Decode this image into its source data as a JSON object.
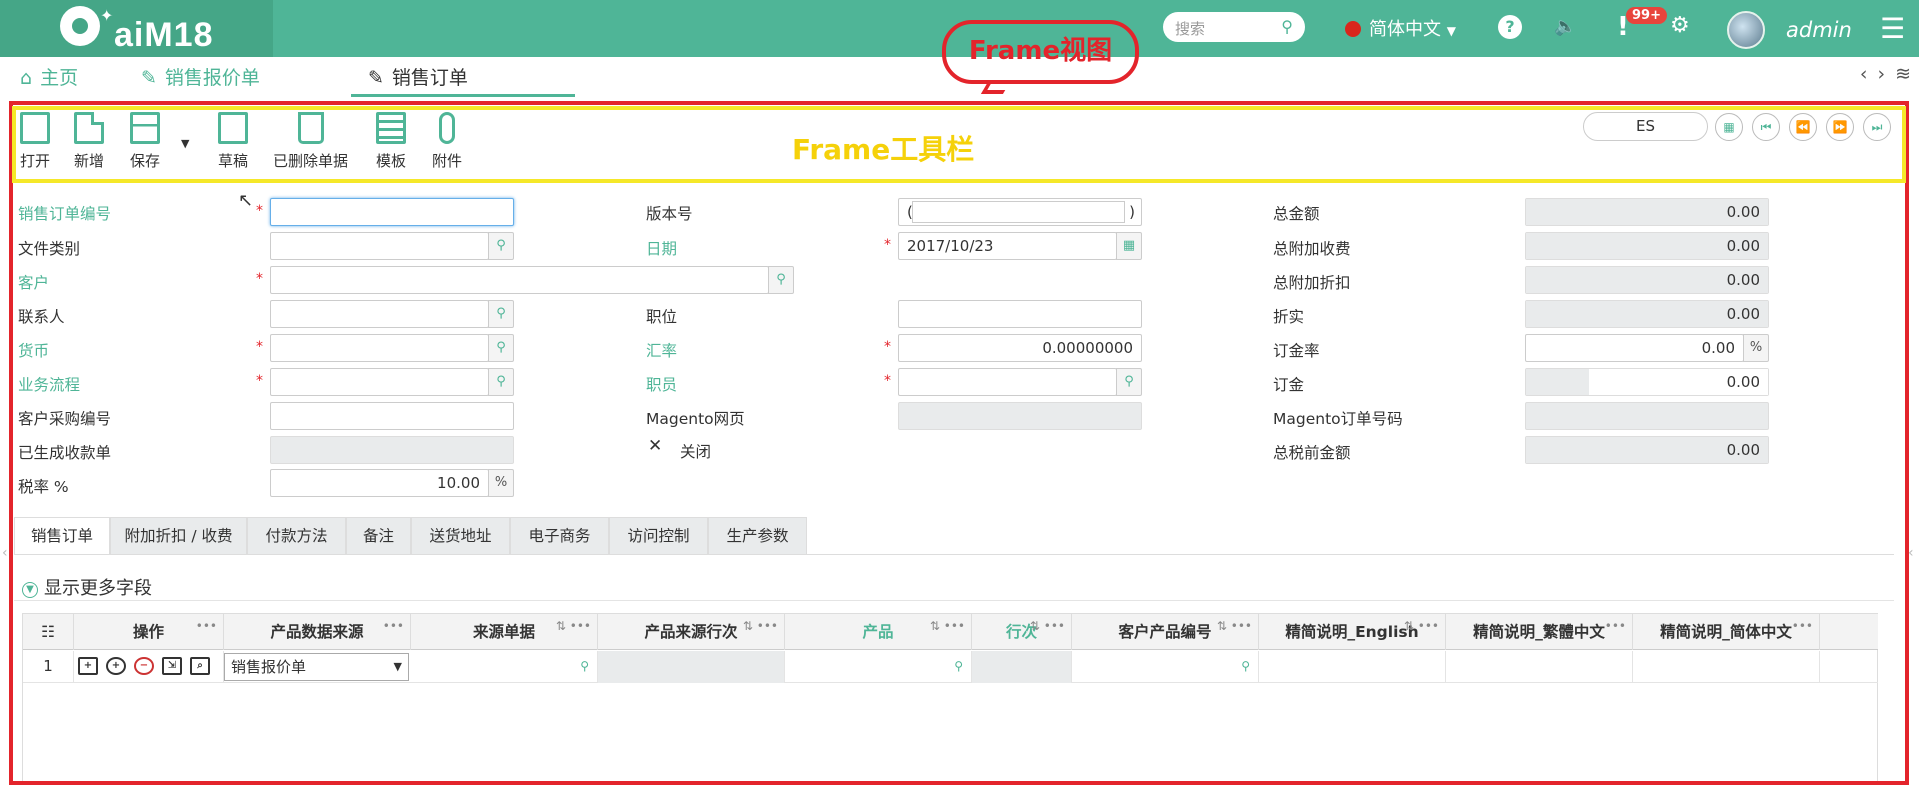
{
  "app": {
    "logo_text": "aiM18",
    "search_placeholder": "搜索",
    "language": "简体中文",
    "help": "?",
    "notifications_badge": "99+",
    "user": "admin"
  },
  "nav_tabs": [
    {
      "label": "主页",
      "icon": "home-icon"
    },
    {
      "label": "销售报价单",
      "icon": "edit-doc-icon"
    },
    {
      "label": "销售订单",
      "icon": "edit-doc-icon",
      "active": true
    }
  ],
  "annotations": {
    "frame_view": "Frame视图",
    "frame_toolbar": "Frame工具栏"
  },
  "toolbar": {
    "buttons": [
      {
        "label": "打开",
        "icon": "open-icon"
      },
      {
        "label": "新增",
        "icon": "new-doc-icon"
      },
      {
        "label": "保存",
        "icon": "save-icon"
      },
      {
        "label": "草稿",
        "icon": "draft-icon"
      },
      {
        "label": "已删除单据",
        "icon": "deleted-docs-icon"
      },
      {
        "label": "模板",
        "icon": "template-icon"
      },
      {
        "label": "附件",
        "icon": "attachment-icon"
      }
    ],
    "es_field": "ES"
  },
  "form": {
    "col1": [
      {
        "label": "销售订单编号",
        "required": true,
        "value": ""
      },
      {
        "label": "文件类别",
        "required": false,
        "value": ""
      },
      {
        "label": "客户",
        "required": true,
        "value": ""
      },
      {
        "label": "联系人",
        "required": false,
        "value": ""
      },
      {
        "label": "货币",
        "required": true,
        "value": ""
      },
      {
        "label": "业务流程",
        "required": true,
        "value": ""
      },
      {
        "label": "客户采购编号",
        "required": false,
        "value": ""
      },
      {
        "label": "已生成收款单",
        "required": false,
        "value": ""
      },
      {
        "label": "税率 %",
        "required": false,
        "value": "10.00",
        "unit": "%"
      }
    ],
    "col2": [
      {
        "label": "版本号",
        "required": false,
        "value": "",
        "prefix": "(",
        "suffix": ")"
      },
      {
        "label": "日期",
        "required": true,
        "value": "2017/10/23"
      },
      {
        "label": "职位",
        "required": false,
        "value": ""
      },
      {
        "label": "汇率",
        "required": true,
        "value": "0.00000000"
      },
      {
        "label": "职员",
        "required": true,
        "value": ""
      },
      {
        "label": "Magento网页",
        "required": false,
        "value": ""
      },
      {
        "label": "关闭",
        "required": false,
        "value": "✕"
      }
    ],
    "col3": [
      {
        "label": "总金额",
        "value": "0.00"
      },
      {
        "label": "总附加收费",
        "value": "0.00"
      },
      {
        "label": "总附加折扣",
        "value": "0.00"
      },
      {
        "label": "折实",
        "value": "0.00"
      },
      {
        "label": "订金率",
        "value": "0.00",
        "unit": "%"
      },
      {
        "label": "订金",
        "value": "0.00"
      },
      {
        "label": "Magento订单号码",
        "value": ""
      },
      {
        "label": "总税前金额",
        "value": "0.00"
      }
    ]
  },
  "detail_tabs": [
    "销售订单",
    "附加折扣 / 收费",
    "付款方法",
    "备注",
    "送货地址",
    "电子商务",
    "访问控制",
    "生产参数"
  ],
  "more_fields": "显示更多字段",
  "grid": {
    "columns": [
      "操作",
      "产品数据来源",
      "来源单据",
      "产品来源行次",
      "产品",
      "行次",
      "客户产品编号",
      "精简说明_English",
      "精简说明_繁體中文",
      "精简说明_简体中文"
    ],
    "rows": [
      {
        "no": "1",
        "source": "销售报价单"
      }
    ]
  },
  "colors": {
    "accent": "#4fb597",
    "frame_red": "#e3242b",
    "frame_yellow": "#f5e829"
  }
}
